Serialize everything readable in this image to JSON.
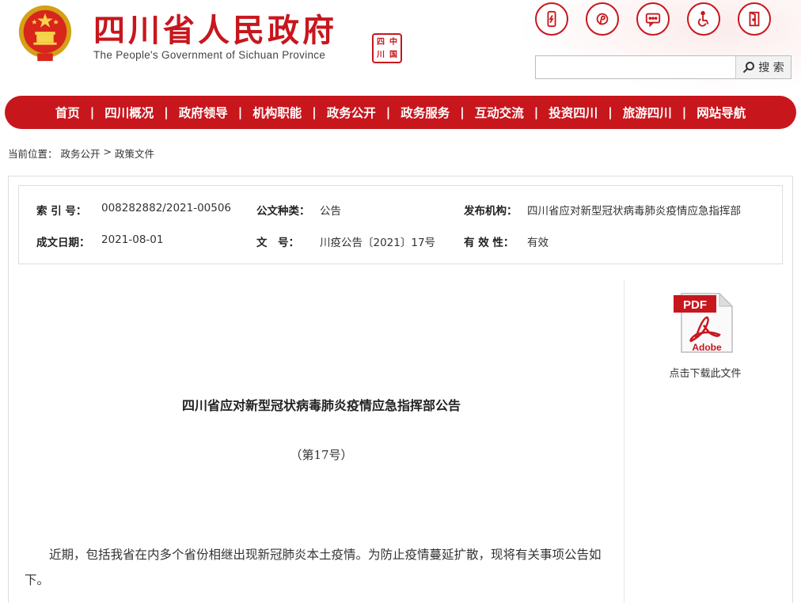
{
  "header": {
    "title": "四川省人民政府",
    "subtitle": "The People's Government of Sichuan Province",
    "seal_chars": [
      "四",
      "中",
      "川",
      "国"
    ],
    "icons": [
      "mobile-icon",
      "weibo-icon",
      "message-icon",
      "accessibility-icon",
      "exit-icon"
    ]
  },
  "search": {
    "placeholder": "",
    "button_label": "搜 索"
  },
  "nav": {
    "items": [
      "首页",
      "四川概况",
      "政府领导",
      "机构职能",
      "政务公开",
      "政务服务",
      "互动交流",
      "投资四川",
      "旅游四川",
      "网站导航"
    ]
  },
  "breadcrumb": {
    "prefix": "当前位置：",
    "level1": "政务公开",
    "separator": ">",
    "level2": "政策文件"
  },
  "info": {
    "index_label": "索 引 号：",
    "index_value": "008282882/2021-00506",
    "type_label": "公文种类：",
    "type_value": "公告",
    "org_label": "发布机构：",
    "org_value": "四川省应对新型冠状病毒肺炎疫情应急指挥部",
    "date_label": "成文日期：",
    "date_value": "2021-08-01",
    "doc_label": "文　号：",
    "doc_value": "川疫公告〔2021〕17号",
    "valid_label": "有 效 性：",
    "valid_value": "有效"
  },
  "document": {
    "title": "四川省应对新型冠状病毒肺炎疫情应急指挥部公告",
    "number": "（第17号）",
    "paragraph": "近期，包括我省在内多个省份相继出现新冠肺炎本土疫情。为防止疫情蔓延扩散，现将有关事项公告如下。"
  },
  "sidebar": {
    "pdf_label": "PDF",
    "pdf_brand": "Adobe",
    "download_label": "点击下载此文件"
  },
  "colors": {
    "brand_red": "#c8161d"
  }
}
